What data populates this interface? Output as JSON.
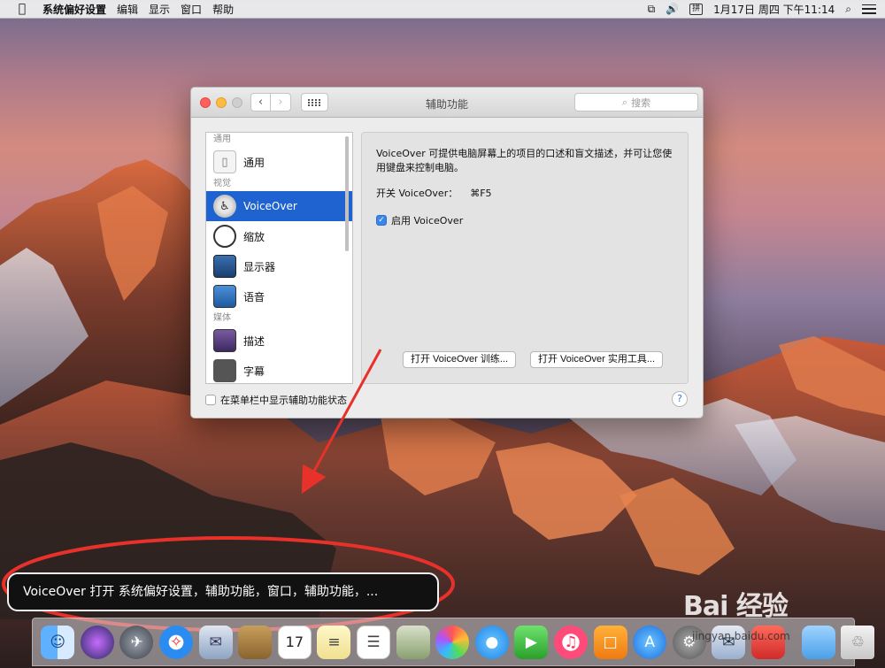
{
  "menubar": {
    "apple_glyph": "",
    "app_name": "系统偏好设置",
    "items": [
      "编辑",
      "显示",
      "窗口",
      "帮助"
    ],
    "input_method": "拼",
    "clock": "1月17日 周四 下午11:14"
  },
  "window": {
    "title": "辅助功能",
    "search_placeholder": "搜索",
    "sidebar": {
      "section_general": "通用",
      "section_vision": "视觉",
      "section_media": "媒体",
      "items": [
        {
          "label": "通用",
          "icon": "general-icon"
        },
        {
          "label": "VoiceOver",
          "icon": "voiceover-icon",
          "selected": true
        },
        {
          "label": "缩放",
          "icon": "zoom-icon"
        },
        {
          "label": "显示器",
          "icon": "display-icon"
        },
        {
          "label": "语音",
          "icon": "speech-icon"
        },
        {
          "label": "描述",
          "icon": "descriptions-icon"
        },
        {
          "label": "字幕",
          "icon": "captions-icon"
        }
      ]
    },
    "panel": {
      "description": "VoiceOver 可提供电脑屏幕上的项目的口述和盲文描述，并可让您使用键盘来控制电脑。",
      "shortcut_label": "开关 VoiceOver：",
      "shortcut_keys": "⌘F5",
      "enable_label": "启用 VoiceOver",
      "enable_checked": true,
      "btn_training": "打开 VoiceOver 训练...",
      "btn_utility": "打开 VoiceOver 实用工具..."
    },
    "footer_checkbox_label": "在菜单栏中显示辅助功能状态",
    "footer_checkbox_checked": false,
    "help_label": "?"
  },
  "voiceover_caption": "VoiceOver 打开 系统偏好设置，辅助功能，窗口，辅助功能，...",
  "dock": {
    "calendar_day": "17",
    "apps": [
      "finder-icon",
      "siri-icon",
      "launchpad-icon",
      "safari-icon",
      "mail-icon",
      "notes-book-icon",
      "calendar-icon",
      "notes-icon",
      "reminders-icon",
      "preview-icon",
      "photos-icon",
      "messages-icon",
      "facetime-icon",
      "itunes-icon",
      "ibooks-icon",
      "appstore-icon",
      "system-preferences-icon",
      "other-app-icon",
      "other-app-2-icon",
      "folder-icon",
      "trash-icon"
    ]
  },
  "watermark": {
    "logo": "Bai 经验",
    "url": "jingyan.baidu.com"
  },
  "colors": {
    "selection": "#1f63d0",
    "annotation_red": "#e8312a",
    "checkbox_blue": "#3a86ea"
  }
}
